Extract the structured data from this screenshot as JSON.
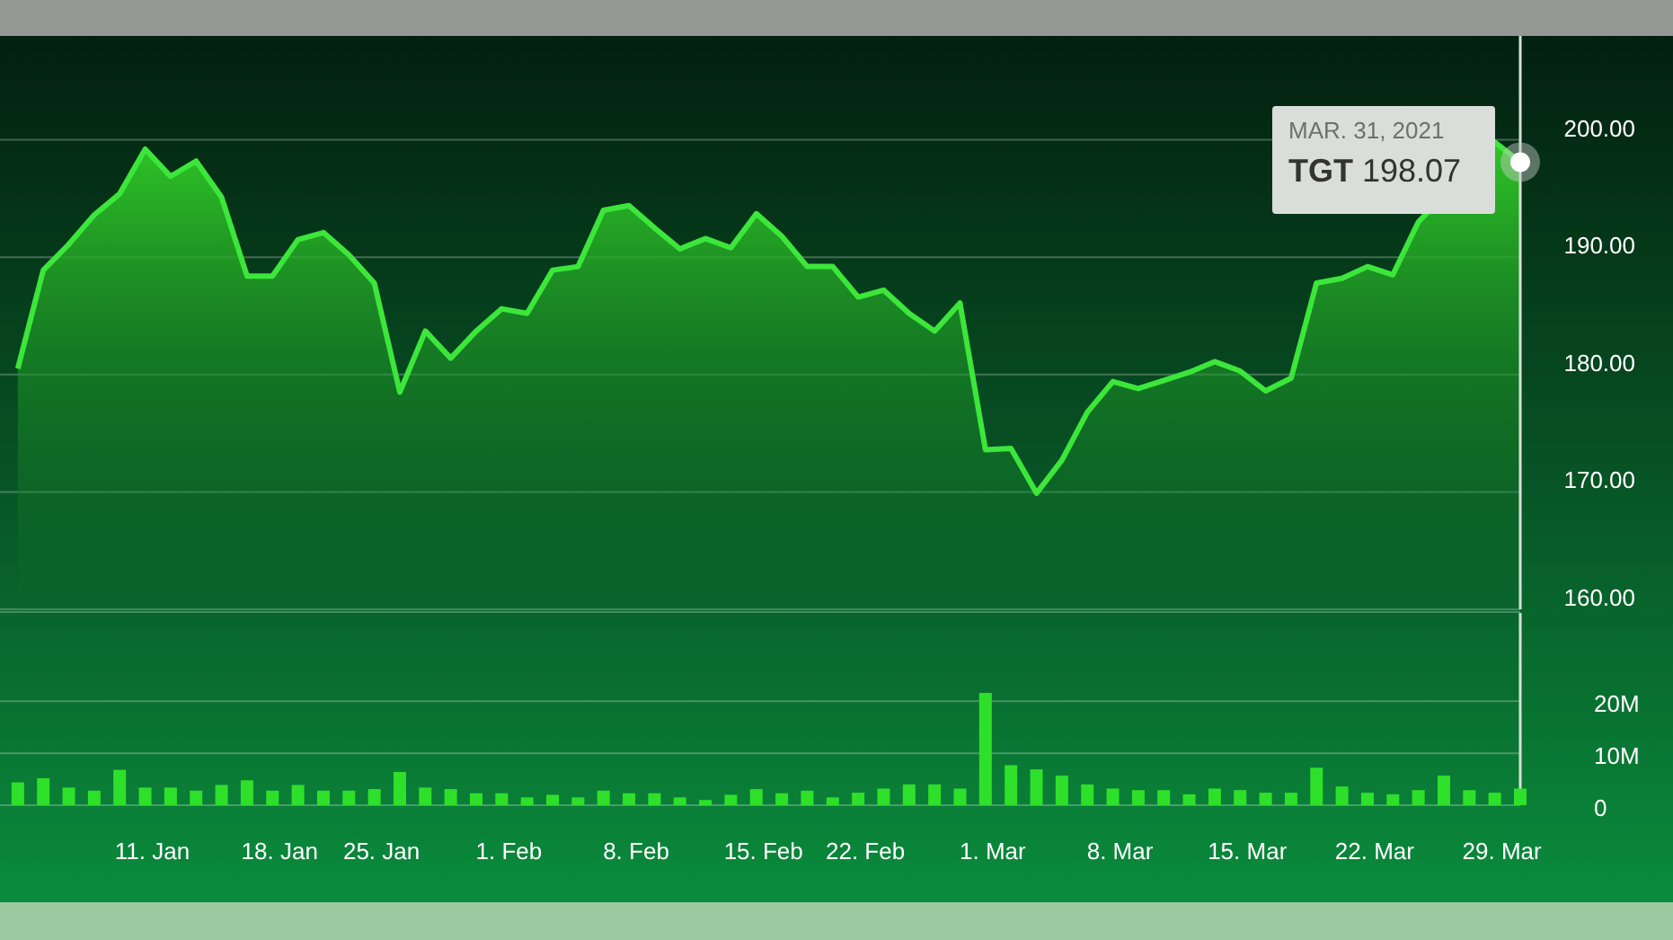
{
  "price_chart": {
    "chart_data": {
      "type": "area",
      "categories": [
        null,
        null,
        null,
        null,
        null,
        null,
        null,
        null,
        null,
        null,
        null,
        null,
        null,
        null,
        null,
        null,
        null,
        null,
        null,
        null,
        null,
        null,
        null,
        null,
        null,
        null,
        null,
        null,
        null,
        null,
        null,
        null,
        null,
        null,
        null,
        null,
        null,
        null,
        null,
        null,
        null,
        null,
        null,
        null,
        null,
        null,
        null,
        null,
        null,
        null,
        null,
        null,
        null,
        null,
        null,
        null,
        null,
        null,
        null,
        null
      ],
      "series": [
        {
          "color": "#3ce63a",
          "values": [
            180.5,
            188.9,
            191.1,
            193.6,
            195.4,
            199.2,
            196.9,
            198.2,
            195.1,
            188.4,
            188.4,
            191.5,
            192.1,
            190.2,
            187.8,
            178.5,
            183.7,
            181.4,
            183.7,
            185.6,
            185.2,
            188.9,
            189.2,
            194.0,
            194.4,
            192.5,
            190.7,
            191.6,
            190.8,
            193.7,
            191.8,
            189.2,
            189.2,
            186.6,
            187.2,
            185.2,
            183.7,
            186.1,
            173.6,
            173.7,
            169.9,
            172.7,
            176.8,
            179.4,
            178.8,
            179.5,
            180.2,
            181.1,
            180.3,
            178.6,
            179.7,
            187.8,
            188.2,
            189.2,
            188.5,
            193.0,
            null,
            null,
            199.8,
            198.1
          ]
        }
      ],
      "grid": true,
      "ylim": [
        160,
        208.7
      ],
      "yticks": [
        {
          "value": 160,
          "label": "160.00"
        },
        {
          "value": 170,
          "label": "170.00"
        },
        {
          "value": 180,
          "label": "180.00"
        },
        {
          "value": 190,
          "label": "190.00"
        },
        {
          "value": 200,
          "label": "200.00"
        }
      ]
    }
  },
  "tooltip": {
    "date": "MAR. 31, 2021",
    "symbol": "TGT",
    "price": "198.07"
  },
  "volume_chart": {
    "chart_data": {
      "type": "bar",
      "categories": [
        null,
        null,
        null,
        null,
        null,
        "11. Jan",
        null,
        null,
        null,
        null,
        "18. Jan",
        null,
        null,
        null,
        "25. Jan",
        null,
        null,
        null,
        null,
        "1. Feb",
        null,
        null,
        null,
        null,
        "8. Feb",
        null,
        null,
        null,
        null,
        "15. Feb",
        null,
        null,
        null,
        "22. Feb",
        null,
        null,
        null,
        null,
        "1. Mar",
        null,
        null,
        null,
        null,
        "8. Mar",
        null,
        null,
        null,
        null,
        "15. Mar",
        null,
        null,
        null,
        null,
        "22. Mar",
        null,
        null,
        null,
        null,
        "29. Mar",
        null
      ],
      "series": [
        {
          "color": "#2fe02a",
          "values": [
            4.4,
            5.2,
            3.4,
            2.8,
            6.8,
            3.4,
            3.4,
            2.8,
            3.9,
            4.8,
            2.8,
            3.9,
            2.8,
            2.8,
            3.1,
            6.4,
            3.4,
            3.1,
            2.3,
            2.3,
            1.5,
            2.0,
            1.5,
            2.8,
            2.3,
            2.3,
            1.5,
            1.0,
            2.0,
            3.1,
            2.3,
            2.8,
            1.5,
            2.4,
            3.2,
            4.0,
            4.0,
            3.2,
            21.6,
            7.7,
            6.9,
            5.7,
            4.0,
            3.2,
            2.9,
            2.9,
            2.1,
            3.2,
            2.9,
            2.4,
            2.4,
            7.2,
            3.6,
            2.4,
            2.1,
            2.9,
            5.7,
            2.9,
            2.4,
            3.2
          ]
        }
      ],
      "grid": true,
      "ylim": [
        0,
        37
      ],
      "yticks": [
        {
          "value": 0,
          "label": "0"
        },
        {
          "value": 10,
          "label": "10M"
        },
        {
          "value": 20,
          "label": "20M"
        }
      ]
    }
  }
}
